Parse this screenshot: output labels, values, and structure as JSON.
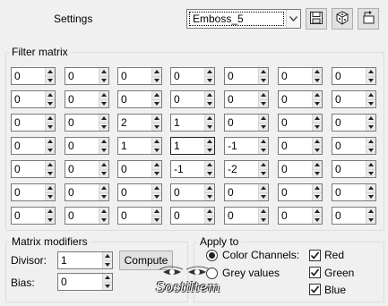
{
  "header": {
    "title": "Settings",
    "preset_value": "Emboss_5"
  },
  "icons": {
    "save": "save-icon",
    "random": "dice-icon",
    "reset": "reset-icon",
    "dropdown": "chevron-down-icon"
  },
  "filter_matrix": {
    "label": "Filter matrix",
    "rows": [
      [
        "0",
        "0",
        "0",
        "0",
        "0",
        "0",
        "0"
      ],
      [
        "0",
        "0",
        "0",
        "0",
        "0",
        "0",
        "0"
      ],
      [
        "0",
        "0",
        "2",
        "1",
        "0",
        "0",
        "0"
      ],
      [
        "0",
        "0",
        "1",
        "1",
        "-1",
        "0",
        "0"
      ],
      [
        "0",
        "0",
        "0",
        "-1",
        "-2",
        "0",
        "0"
      ],
      [
        "0",
        "0",
        "0",
        "0",
        "0",
        "0",
        "0"
      ],
      [
        "0",
        "0",
        "0",
        "0",
        "0",
        "0",
        "0"
      ]
    ],
    "focused_cell": [
      3,
      3
    ]
  },
  "modifiers": {
    "label": "Matrix modifiers",
    "divisor_label": "Divisor:",
    "divisor_value": "1",
    "bias_label": "Bias:",
    "bias_value": "0",
    "compute_label": "Compute"
  },
  "apply_to": {
    "label": "Apply to",
    "color_channels_label": "Color Channels:",
    "grey_values_label": "Grey values",
    "selected": "color_channels",
    "red_label": "Red",
    "green_label": "Green",
    "blue_label": "Blue",
    "red_checked": true,
    "green_checked": true,
    "blue_checked": true
  },
  "watermark": {
    "text": "Sostiltem"
  }
}
